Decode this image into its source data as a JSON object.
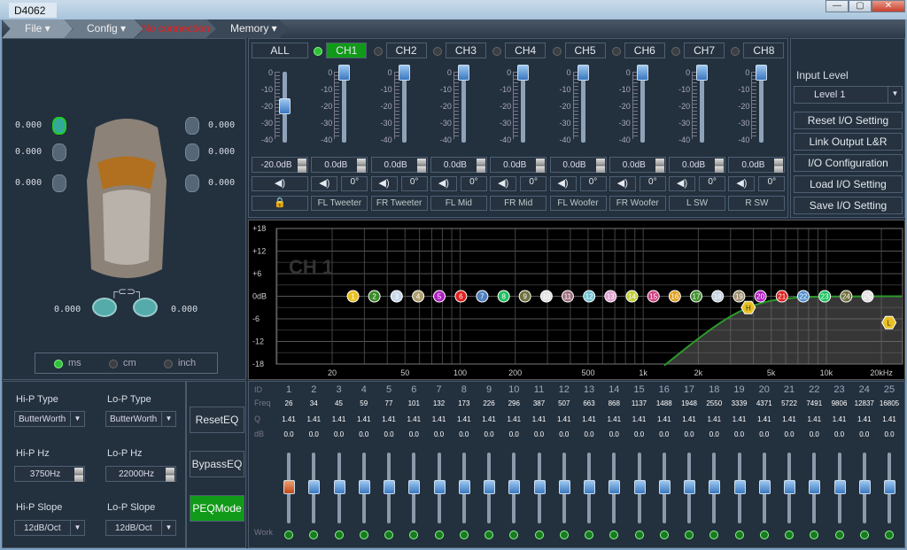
{
  "window": {
    "title": "D4062",
    "buttons": [
      "—",
      "▢",
      "✕"
    ]
  },
  "menu": [
    {
      "label": "File ▾"
    },
    {
      "label": "Config ▾"
    },
    {
      "label": "No connection",
      "color": "#e02020"
    },
    {
      "label": "Memory ▾"
    }
  ],
  "delay": {
    "fl": [
      "0.000",
      "0.000",
      "0.000"
    ],
    "fr": [
      "0.000",
      "0.000",
      "0.000"
    ],
    "sub_l": "0.000",
    "sub_r": "0.000",
    "units": [
      "ms",
      "cm",
      "inch"
    ],
    "selected_unit": "ms"
  },
  "channels": [
    {
      "label": "ALL",
      "gain": "-20.0dB",
      "level": -20,
      "active": false,
      "name_label": "",
      "lock_icon": "lock-icon"
    },
    {
      "label": "CH1",
      "gain": "0.0dB",
      "level": 0,
      "active": true,
      "phase": "0°",
      "name_label": "FL Tweeter"
    },
    {
      "label": "CH2",
      "gain": "0.0dB",
      "level": 0,
      "active": false,
      "phase": "0°",
      "name_label": "FR Tweeter"
    },
    {
      "label": "CH3",
      "gain": "0.0dB",
      "level": 0,
      "active": false,
      "phase": "0°",
      "name_label": "FL Mid"
    },
    {
      "label": "CH4",
      "gain": "0.0dB",
      "level": 0,
      "active": false,
      "phase": "0°",
      "name_label": "FR Mid"
    },
    {
      "label": "CH5",
      "gain": "0.0dB",
      "level": 0,
      "active": false,
      "phase": "0°",
      "name_label": "FL Woofer"
    },
    {
      "label": "CH6",
      "gain": "0.0dB",
      "level": 0,
      "active": false,
      "phase": "0°",
      "name_label": "FR Woofer"
    },
    {
      "label": "CH7",
      "gain": "0.0dB",
      "level": 0,
      "active": false,
      "phase": "0°",
      "name_label": "L SW"
    },
    {
      "label": "CH8",
      "gain": "0.0dB",
      "level": 0,
      "active": false,
      "phase": "0°",
      "name_label": "R SW"
    }
  ],
  "fader_scale": [
    "0",
    "-10",
    "-20",
    "-30",
    "-40"
  ],
  "io": {
    "input_level_label": "Input Level",
    "input_level": "Level 1",
    "buttons": [
      "Reset I/O Setting",
      "Link Output L&R",
      "I/O Configuration",
      "Load I/O Setting",
      "Save I/O Setting"
    ]
  },
  "graph": {
    "watermark": "CH 1",
    "y_ticks": [
      "+18",
      "+12",
      "+6",
      "0dB",
      "-6",
      "-12",
      "-18"
    ],
    "y_vals": [
      18,
      12,
      6,
      0,
      -6,
      -12,
      -18
    ],
    "x_ticks": [
      "20",
      "50",
      "100",
      "200",
      "500",
      "1k",
      "2k",
      "5k",
      "10k",
      "20kHz"
    ],
    "x_vals": [
      20,
      50,
      100,
      200,
      500,
      1000,
      2000,
      5000,
      10000,
      20000
    ],
    "curve_color": "#2a9a2a",
    "hp_marker": {
      "label": "H",
      "freq": 3750,
      "db": -3
    },
    "lp_marker": {
      "label": "L",
      "freq": 22000,
      "db": -7
    },
    "point_colors": [
      "#e8c020",
      "#3a8a2a",
      "#c8d8e8",
      "#b0a070",
      "#b020c0",
      "#e02020",
      "#5080c0",
      "#20c060",
      "#707040",
      "#e0e0e0",
      "#a07080",
      "#70c0d0",
      "#e0a0d0",
      "#c0d030",
      "#d04080",
      "#e0a020",
      "#409030",
      "#c0d0e0",
      "#a09070",
      "#b020c0",
      "#e02020",
      "#5090d0",
      "#20c060",
      "#707040",
      "#e0e0e0"
    ]
  },
  "filters": {
    "hp_type_label": "Hi-P Type",
    "hp_type": "ButterWorth",
    "lp_type_label": "Lo-P Type",
    "lp_type": "ButterWorth",
    "hp_hz_label": "Hi-P Hz",
    "hp_hz": "3750Hz",
    "lp_hz_label": "Lo-P Hz",
    "lp_hz": "22000Hz",
    "hp_slope_label": "Hi-P Slope",
    "hp_slope": "12dB/Oct",
    "lp_slope_label": "Lo-P Slope",
    "lp_slope": "12dB/Oct"
  },
  "eq_buttons": [
    "ResetEQ",
    "BypassEQ",
    "PEQMode"
  ],
  "eq": {
    "row_labels": [
      "ID",
      "Freq",
      "Q",
      "dB",
      "Work"
    ],
    "freq": [
      26,
      34,
      45,
      59,
      77,
      101,
      132,
      173,
      226,
      296,
      387,
      507,
      663,
      868,
      1137,
      1488,
      1948,
      2550,
      3339,
      4371,
      5722,
      7491,
      9806,
      12837,
      16805
    ],
    "q": "1.41",
    "db": "0.0",
    "selected_band": 1
  }
}
